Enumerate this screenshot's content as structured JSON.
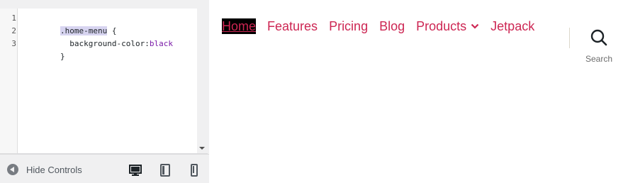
{
  "editor": {
    "line_numbers": [
      "1",
      "2",
      "3"
    ],
    "lines": {
      "l1_selector": ".home-menu",
      "l1_rest": " {",
      "l2_prop": "  background-color:",
      "l2_value": "black",
      "l3": "}"
    }
  },
  "controls": {
    "hide_label": "Hide Controls"
  },
  "preview": {
    "nav": {
      "items": [
        "Home",
        "Features",
        "Pricing",
        "Blog",
        "Products",
        "Jetpack"
      ]
    },
    "search_label": "Search"
  },
  "colors": {
    "link": "#cd2653",
    "active_bg": "#000000",
    "panel_bg": "#f0f0f1"
  },
  "icons": {
    "hide_controls": "arrow-left-circle-icon",
    "desktop": "desktop-icon",
    "tablet": "tablet-icon",
    "mobile": "mobile-icon",
    "products_dropdown": "chevron-down-icon",
    "search": "search-icon"
  }
}
